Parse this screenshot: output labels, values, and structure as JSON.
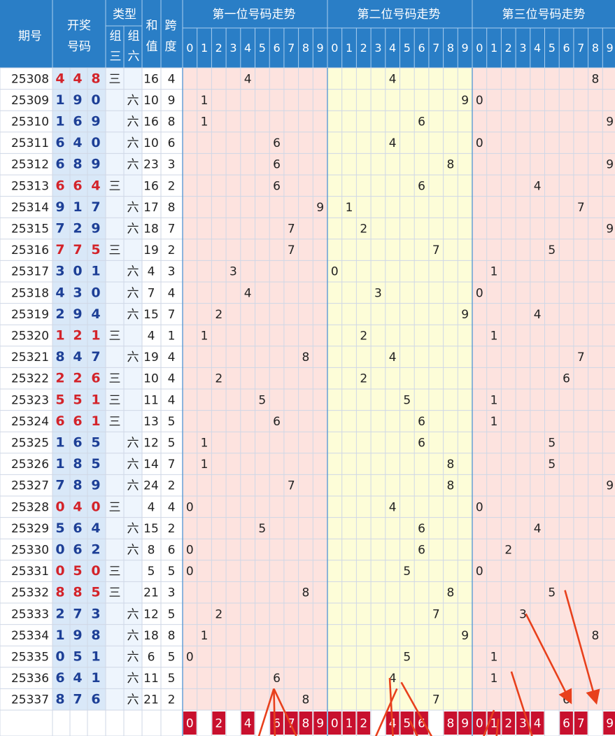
{
  "header": {
    "period": "期号",
    "draw_line1": "开奖",
    "draw_line2": "号码",
    "type": "类型",
    "z3_line1": "组",
    "z3_line2": "三",
    "z6_line1": "组",
    "z6_line2": "六",
    "sum_line1": "和",
    "sum_line2": "值",
    "span_line1": "跨",
    "span_line2": "度",
    "digit_groups": [
      "第一位号码走势",
      "第二位号码走势",
      "第三位号码走势"
    ]
  },
  "digits": [
    "0",
    "1",
    "2",
    "3",
    "4",
    "5",
    "6",
    "7",
    "8",
    "9"
  ],
  "type_labels": {
    "z3": "三",
    "z6": "六"
  },
  "chart_data": {
    "type": "table",
    "rows": [
      {
        "period": "25308",
        "d": [
          4,
          4,
          8
        ],
        "type": "z3",
        "sum": 16,
        "span": 4
      },
      {
        "period": "25309",
        "d": [
          1,
          9,
          0
        ],
        "type": "z6",
        "sum": 10,
        "span": 9
      },
      {
        "period": "25310",
        "d": [
          1,
          6,
          9
        ],
        "type": "z6",
        "sum": 16,
        "span": 8
      },
      {
        "period": "25311",
        "d": [
          6,
          4,
          0
        ],
        "type": "z6",
        "sum": 10,
        "span": 6
      },
      {
        "period": "25312",
        "d": [
          6,
          8,
          9
        ],
        "type": "z6",
        "sum": 23,
        "span": 3
      },
      {
        "period": "25313",
        "d": [
          6,
          6,
          4
        ],
        "type": "z3",
        "sum": 16,
        "span": 2
      },
      {
        "period": "25314",
        "d": [
          9,
          1,
          7
        ],
        "type": "z6",
        "sum": 17,
        "span": 8
      },
      {
        "period": "25315",
        "d": [
          7,
          2,
          9
        ],
        "type": "z6",
        "sum": 18,
        "span": 7
      },
      {
        "period": "25316",
        "d": [
          7,
          7,
          5
        ],
        "type": "z3",
        "sum": 19,
        "span": 2
      },
      {
        "period": "25317",
        "d": [
          3,
          0,
          1
        ],
        "type": "z6",
        "sum": 4,
        "span": 3
      },
      {
        "period": "25318",
        "d": [
          4,
          3,
          0
        ],
        "type": "z6",
        "sum": 7,
        "span": 4
      },
      {
        "period": "25319",
        "d": [
          2,
          9,
          4
        ],
        "type": "z6",
        "sum": 15,
        "span": 7
      },
      {
        "period": "25320",
        "d": [
          1,
          2,
          1
        ],
        "type": "z3",
        "sum": 4,
        "span": 1
      },
      {
        "period": "25321",
        "d": [
          8,
          4,
          7
        ],
        "type": "z6",
        "sum": 19,
        "span": 4
      },
      {
        "period": "25322",
        "d": [
          2,
          2,
          6
        ],
        "type": "z3",
        "sum": 10,
        "span": 4
      },
      {
        "period": "25323",
        "d": [
          5,
          5,
          1
        ],
        "type": "z3",
        "sum": 11,
        "span": 4
      },
      {
        "period": "25324",
        "d": [
          6,
          6,
          1
        ],
        "type": "z3",
        "sum": 13,
        "span": 5
      },
      {
        "period": "25325",
        "d": [
          1,
          6,
          5
        ],
        "type": "z6",
        "sum": 12,
        "span": 5
      },
      {
        "period": "25326",
        "d": [
          1,
          8,
          5
        ],
        "type": "z6",
        "sum": 14,
        "span": 7
      },
      {
        "period": "25327",
        "d": [
          7,
          8,
          9
        ],
        "type": "z6",
        "sum": 24,
        "span": 2
      },
      {
        "period": "25328",
        "d": [
          0,
          4,
          0
        ],
        "type": "z3",
        "sum": 4,
        "span": 4
      },
      {
        "period": "25329",
        "d": [
          5,
          6,
          4
        ],
        "type": "z6",
        "sum": 15,
        "span": 2
      },
      {
        "period": "25330",
        "d": [
          0,
          6,
          2
        ],
        "type": "z6",
        "sum": 8,
        "span": 6
      },
      {
        "period": "25331",
        "d": [
          0,
          5,
          0
        ],
        "type": "z3",
        "sum": 5,
        "span": 5
      },
      {
        "period": "25332",
        "d": [
          8,
          8,
          5
        ],
        "type": "z3",
        "sum": 21,
        "span": 3
      },
      {
        "period": "25333",
        "d": [
          2,
          7,
          3
        ],
        "type": "z6",
        "sum": 12,
        "span": 5
      },
      {
        "period": "25334",
        "d": [
          1,
          9,
          8
        ],
        "type": "z6",
        "sum": 18,
        "span": 8
      },
      {
        "period": "25335",
        "d": [
          0,
          5,
          1
        ],
        "type": "z6",
        "sum": 6,
        "span": 5
      },
      {
        "period": "25336",
        "d": [
          6,
          4,
          1
        ],
        "type": "z6",
        "sum": 11,
        "span": 5
      },
      {
        "period": "25337",
        "d": [
          8,
          7,
          6
        ],
        "type": "z6",
        "sum": 21,
        "span": 2
      }
    ],
    "picks": [
      [
        0,
        2,
        4,
        6,
        7,
        8,
        9
      ],
      [
        0,
        1,
        2,
        4,
        5,
        6,
        8,
        9
      ],
      [
        0,
        1,
        2,
        3,
        4,
        6,
        7,
        9
      ]
    ],
    "arrows": [
      {
        "group": 0,
        "from": 6.3,
        "from_row": 29.0,
        "to": 4.9,
        "to_row": 32.0
      },
      {
        "group": 0,
        "from": 6.3,
        "from_row": 29.0,
        "to": 6.4,
        "to_row": 32.0
      },
      {
        "group": 0,
        "from": 6.3,
        "from_row": 29.0,
        "to": 8.4,
        "to_row": 32.0
      },
      {
        "group": 1,
        "from": 4.8,
        "from_row": 29.0,
        "to": 2.7,
        "to_row": 32.2
      },
      {
        "group": 1,
        "from": 4.3,
        "from_row": 28.5,
        "to": 4.6,
        "to_row": 32.2
      },
      {
        "group": 1,
        "from": 5.1,
        "from_row": 28.7,
        "to": 8.0,
        "to_row": 32.2
      },
      {
        "group": 1,
        "from": 5.7,
        "from_row": 30.5,
        "to": 6.9,
        "to_row": 32.2
      },
      {
        "group": 2,
        "from": 1.5,
        "from_row": 30.0,
        "to": 0.1,
        "to_row": 32.4
      },
      {
        "group": 2,
        "from": 1.8,
        "from_row": 30.4,
        "to": 1.5,
        "to_row": 32.4
      },
      {
        "group": 2,
        "from": 2.7,
        "from_row": 28.2,
        "to": 4.5,
        "to_row": 32.0
      },
      {
        "group": 2,
        "from": 3.7,
        "from_row": 25.5,
        "to": 6.7,
        "to_row": 29.5
      },
      {
        "group": 2,
        "from": 6.4,
        "from_row": 24.4,
        "to": 8.5,
        "to_row": 29.5
      }
    ]
  }
}
